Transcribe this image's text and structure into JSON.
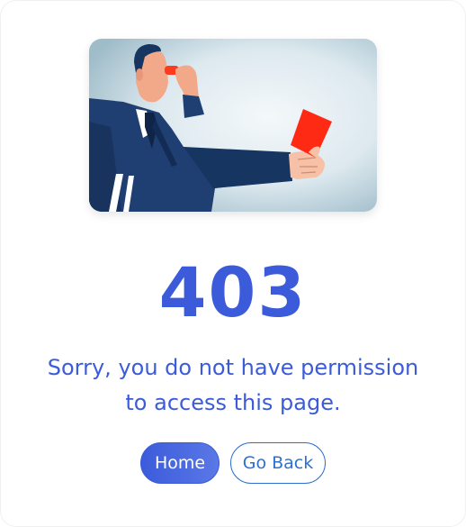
{
  "error": {
    "code": "403",
    "message_line1": "Sorry, you do not have permission",
    "message_line2": "to access this page."
  },
  "buttons": {
    "home_label": "Home",
    "back_label": "Go Back"
  },
  "colors": {
    "accent": "#3b5bdb",
    "secondary_border": "#2f6fd1",
    "red_card": "#ff2a14",
    "suit": "#1f3f73"
  },
  "illustration": {
    "icon": "referee-red-card-illustration"
  }
}
